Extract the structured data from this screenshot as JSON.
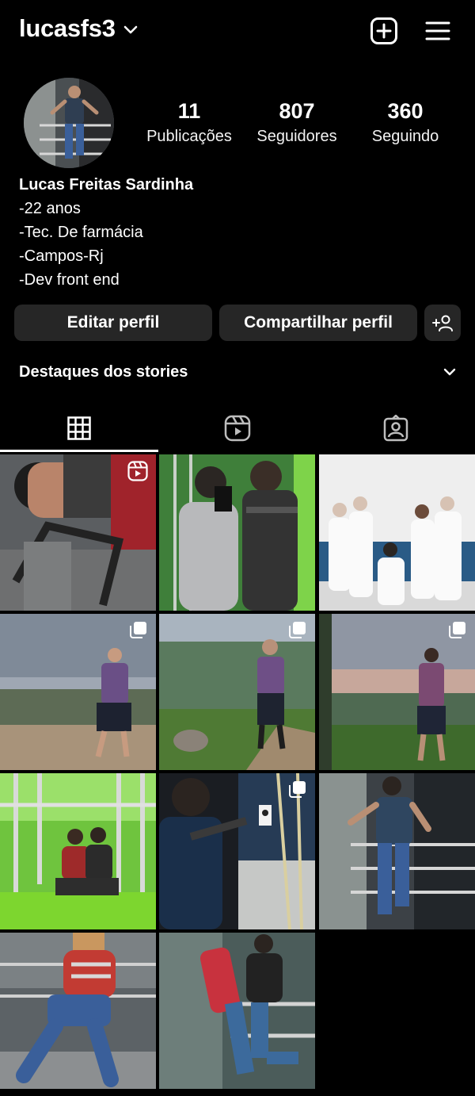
{
  "header": {
    "username": "lucasfs3",
    "icons": [
      "chevron-down-icon",
      "plus-square-icon",
      "hamburger-menu-icon"
    ]
  },
  "profile": {
    "stats": [
      {
        "value": "11",
        "label": "Publicações"
      },
      {
        "value": "807",
        "label": "Seguidores"
      },
      {
        "value": "360",
        "label": "Seguindo"
      }
    ],
    "name": "Lucas Freitas Sardinha",
    "bio_lines": [
      "-22 anos",
      "-Tec. De farmácia",
      "-Campos-Rj",
      "-Dev front end"
    ]
  },
  "actions": {
    "edit_label": "Editar perfil",
    "share_label": "Compartilhar perfil",
    "add_person_icon": "add-person-icon"
  },
  "highlights": {
    "title": "Destaques dos stories"
  },
  "tabs": [
    {
      "name": "grid-icon",
      "active": true
    },
    {
      "name": "reels-icon",
      "active": false
    },
    {
      "name": "tagged-icon",
      "active": false
    }
  ],
  "posts": [
    {
      "scene": "gym-curl",
      "badge": "reel-icon"
    },
    {
      "scene": "gym-mirror-selfie",
      "badge": ""
    },
    {
      "scene": "group-white-coats",
      "badge": ""
    },
    {
      "scene": "hilltop-pose",
      "badge": "carousel-icon"
    },
    {
      "scene": "hilltop-valley",
      "badge": "carousel-icon"
    },
    {
      "scene": "hilltop-sunset",
      "badge": "carousel-icon"
    },
    {
      "scene": "green-gym-group",
      "badge": ""
    },
    {
      "scene": "shooting-range",
      "badge": "carousel-icon"
    },
    {
      "scene": "balcony-pose",
      "badge": ""
    },
    {
      "scene": "red-hoodie-sitting",
      "badge": ""
    },
    {
      "scene": "red-backpack",
      "badge": ""
    }
  ],
  "colors": {
    "background": "#000000",
    "button": "#262626",
    "text": "#ffffff"
  }
}
